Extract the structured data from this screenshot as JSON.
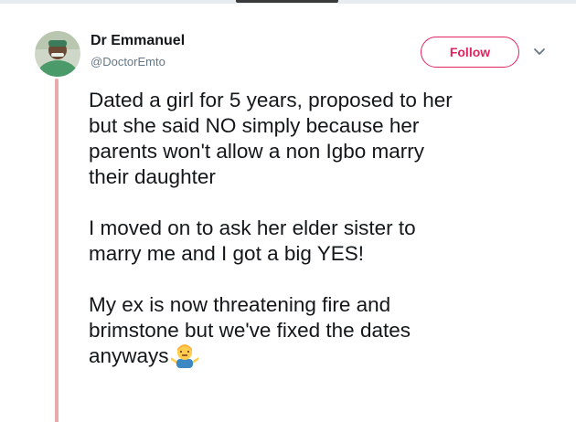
{
  "user": {
    "display_name": "Dr Emmanuel",
    "handle": "@DoctorEmto"
  },
  "follow_button": {
    "label": "Follow"
  },
  "colors": {
    "accent": "#e0245e",
    "thread_line": "#e8a9ad",
    "handle_gray": "#657786",
    "text": "#14171a"
  },
  "tweet": {
    "paragraphs": [
      "Dated a girl for 5 years, proposed to  her\nbut she said NO simply because her\nparents won't allow a non Igbo marry\ntheir daughter",
      "I moved on to ask her elder sister to\nmarry me and I got a big YES!",
      "My ex is now threatening fire and\nbrimstone but we've fixed the dates\nanyways"
    ],
    "emoji": "man-shrugging-icon"
  },
  "icons": {
    "avatar": "user-avatar",
    "menu": "chevron-down-icon"
  }
}
